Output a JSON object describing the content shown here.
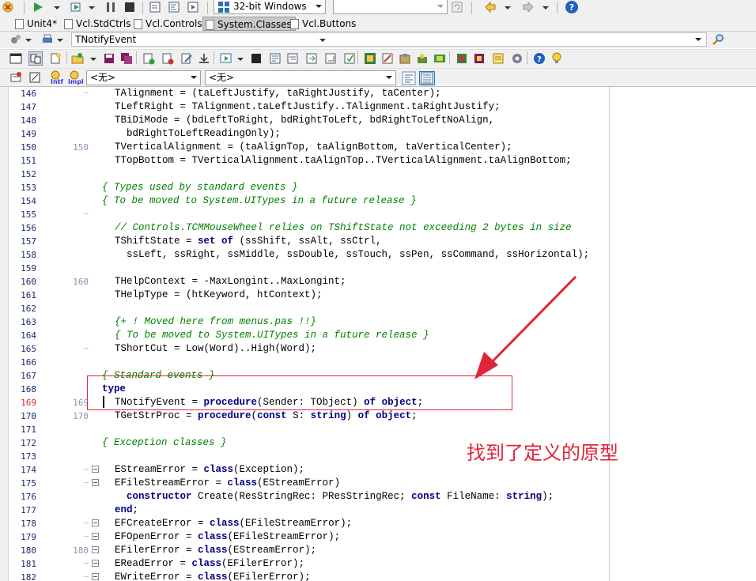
{
  "toolbar_top": {
    "platform_combo": "32-bit Windows",
    "empty_combo": ""
  },
  "tabs": [
    {
      "label": "Unit4*",
      "active": false
    },
    {
      "label": "Vcl.StdCtrls",
      "active": false
    },
    {
      "label": "Vcl.Controls",
      "active": false
    },
    {
      "label": "System.Classes",
      "active": true
    },
    {
      "label": "Vcl.Buttons",
      "active": false
    }
  ],
  "search_bar": {
    "symbol_combo": "TNotifyEvent"
  },
  "class_bar": {
    "class_combo": "<无>",
    "method_combo": "<无>",
    "intf_label": "Intf",
    "impl_label": "Impl"
  },
  "editor": {
    "current_line": "169",
    "lines": [
      {
        "n": "146",
        "mark": "-",
        "code": [
          [
            "",
            "TAlignment = (taLeftJustify, taRightJustify, taCenter);"
          ]
        ]
      },
      {
        "n": "147",
        "mark": "",
        "code": [
          [
            "",
            "TLeftRight = TAlignment.taLeftJustify..TAlignment.taRightJustify;"
          ]
        ]
      },
      {
        "n": "148",
        "mark": "",
        "code": [
          [
            "",
            "TBiDiMode = (bdLeftToRight, bdRightToLeft, bdRightToLeftNoAlign,"
          ]
        ]
      },
      {
        "n": "149",
        "mark": "",
        "code": [
          [
            "",
            "  bdRightToLeftReadingOnly);"
          ]
        ]
      },
      {
        "n": "150",
        "mark": "150",
        "code": [
          [
            "",
            "TVerticalAlignment = (taAlignTop, taAlignBottom, taVerticalCenter);"
          ]
        ]
      },
      {
        "n": "151",
        "mark": "",
        "code": [
          [
            "",
            "TTopBottom = TVerticalAlignment.taAlignTop..TVerticalAlignment.taAlignBottom;"
          ]
        ]
      },
      {
        "n": "152",
        "mark": "",
        "code": []
      },
      {
        "n": "153",
        "mark": "",
        "code": [
          [
            "cm",
            "{ Types used by standard events }"
          ]
        ],
        "outdent": true
      },
      {
        "n": "154",
        "mark": "",
        "code": [
          [
            "cm",
            "{ To be moved to System.UITypes in a future release }"
          ]
        ],
        "outdent": true
      },
      {
        "n": "155",
        "mark": "-",
        "code": []
      },
      {
        "n": "156",
        "mark": "",
        "code": [
          [
            "cm",
            "// Controls.TCMMouseWheel relies on TShiftState not exceeding 2 bytes in size"
          ]
        ]
      },
      {
        "n": "157",
        "mark": "",
        "code": [
          [
            "",
            "TShiftState = "
          ],
          [
            "kw",
            "set of"
          ],
          [
            "",
            " (ssShift, ssAlt, ssCtrl,"
          ]
        ]
      },
      {
        "n": "158",
        "mark": "",
        "code": [
          [
            "",
            "  ssLeft, ssRight, ssMiddle, ssDouble, ssTouch, ssPen, ssCommand, ssHorizontal);"
          ]
        ]
      },
      {
        "n": "159",
        "mark": "",
        "code": []
      },
      {
        "n": "160",
        "mark": "160",
        "code": [
          [
            "",
            "THelpContext = -MaxLongint..MaxLongint;"
          ]
        ]
      },
      {
        "n": "161",
        "mark": "",
        "code": [
          [
            "",
            "THelpType = (htKeyword, htContext);"
          ]
        ]
      },
      {
        "n": "162",
        "mark": "",
        "code": []
      },
      {
        "n": "163",
        "mark": "",
        "code": [
          [
            "cm",
            "{+ ! Moved here from menus.pas !!}"
          ]
        ]
      },
      {
        "n": "164",
        "mark": "",
        "code": [
          [
            "cm",
            "{ To be moved to System.UITypes in a future release }"
          ]
        ]
      },
      {
        "n": "165",
        "mark": "-",
        "code": [
          [
            "",
            "TShortCut = Low(Word)..High(Word);"
          ]
        ]
      },
      {
        "n": "166",
        "mark": "",
        "code": []
      },
      {
        "n": "167",
        "mark": "",
        "code": [
          [
            "cm",
            "{ Standard events }"
          ]
        ],
        "outdent": true
      },
      {
        "n": "168",
        "mark": "",
        "code": [
          [
            "kw",
            "type"
          ]
        ],
        "outdent": true
      },
      {
        "n": "169",
        "mark": "169",
        "code": [
          [
            "",
            "TNotifyEvent = "
          ],
          [
            "kw",
            "procedure"
          ],
          [
            "",
            "(Sender: TObject) "
          ],
          [
            "kw",
            "of object"
          ],
          [
            "",
            ";"
          ]
        ]
      },
      {
        "n": "170",
        "mark": "170",
        "code": [
          [
            "",
            "TGetStrProc = "
          ],
          [
            "kw",
            "procedure"
          ],
          [
            "",
            "("
          ],
          [
            "kw",
            "const"
          ],
          [
            "",
            " S: "
          ],
          [
            "kw",
            "string"
          ],
          [
            "",
            ") "
          ],
          [
            "kw",
            "of object"
          ],
          [
            "",
            ";"
          ]
        ]
      },
      {
        "n": "171",
        "mark": "",
        "code": []
      },
      {
        "n": "172",
        "mark": "",
        "code": [
          [
            "cm",
            "{ Exception classes }"
          ]
        ],
        "outdent": true
      },
      {
        "n": "173",
        "mark": "",
        "code": []
      },
      {
        "n": "174",
        "mark": "-",
        "fold": true,
        "code": [
          [
            "",
            "EStreamError = "
          ],
          [
            "kw",
            "class"
          ],
          [
            "",
            "(Exception);"
          ]
        ]
      },
      {
        "n": "175",
        "mark": "-",
        "fold": true,
        "code": [
          [
            "",
            "EFileStreamError = "
          ],
          [
            "kw",
            "class"
          ],
          [
            "",
            "(EStreamError)"
          ]
        ]
      },
      {
        "n": "176",
        "mark": "",
        "code": [
          [
            "",
            "  "
          ],
          [
            "kw",
            "constructor"
          ],
          [
            "",
            " Create(ResStringRec: PResStringRec; "
          ],
          [
            "kw",
            "const"
          ],
          [
            "",
            " FileName: "
          ],
          [
            "kw",
            "string"
          ],
          [
            "",
            ");"
          ]
        ]
      },
      {
        "n": "177",
        "mark": "",
        "code": [
          [
            "kw",
            "end"
          ],
          [
            "",
            ";"
          ]
        ]
      },
      {
        "n": "178",
        "mark": "-",
        "fold": true,
        "code": [
          [
            "",
            "EFCreateError = "
          ],
          [
            "kw",
            "class"
          ],
          [
            "",
            "(EFileStreamError);"
          ]
        ]
      },
      {
        "n": "179",
        "mark": "-",
        "fold": true,
        "code": [
          [
            "",
            "EFOpenError = "
          ],
          [
            "kw",
            "class"
          ],
          [
            "",
            "(EFileStreamError);"
          ]
        ]
      },
      {
        "n": "180",
        "mark": "180",
        "fold": true,
        "code": [
          [
            "",
            "EFilerError = "
          ],
          [
            "kw",
            "class"
          ],
          [
            "",
            "(EStreamError);"
          ]
        ]
      },
      {
        "n": "181",
        "mark": "-",
        "fold": true,
        "code": [
          [
            "",
            "EReadError = "
          ],
          [
            "kw",
            "class"
          ],
          [
            "",
            "(EFilerError);"
          ]
        ]
      },
      {
        "n": "182",
        "mark": "-",
        "fold": true,
        "code": [
          [
            "",
            "EWriteError = "
          ],
          [
            "kw",
            "class"
          ],
          [
            "",
            "(EFilerError);"
          ]
        ]
      }
    ]
  },
  "annotation": {
    "text": "找到了定义的原型",
    "color": "#e0243a"
  }
}
